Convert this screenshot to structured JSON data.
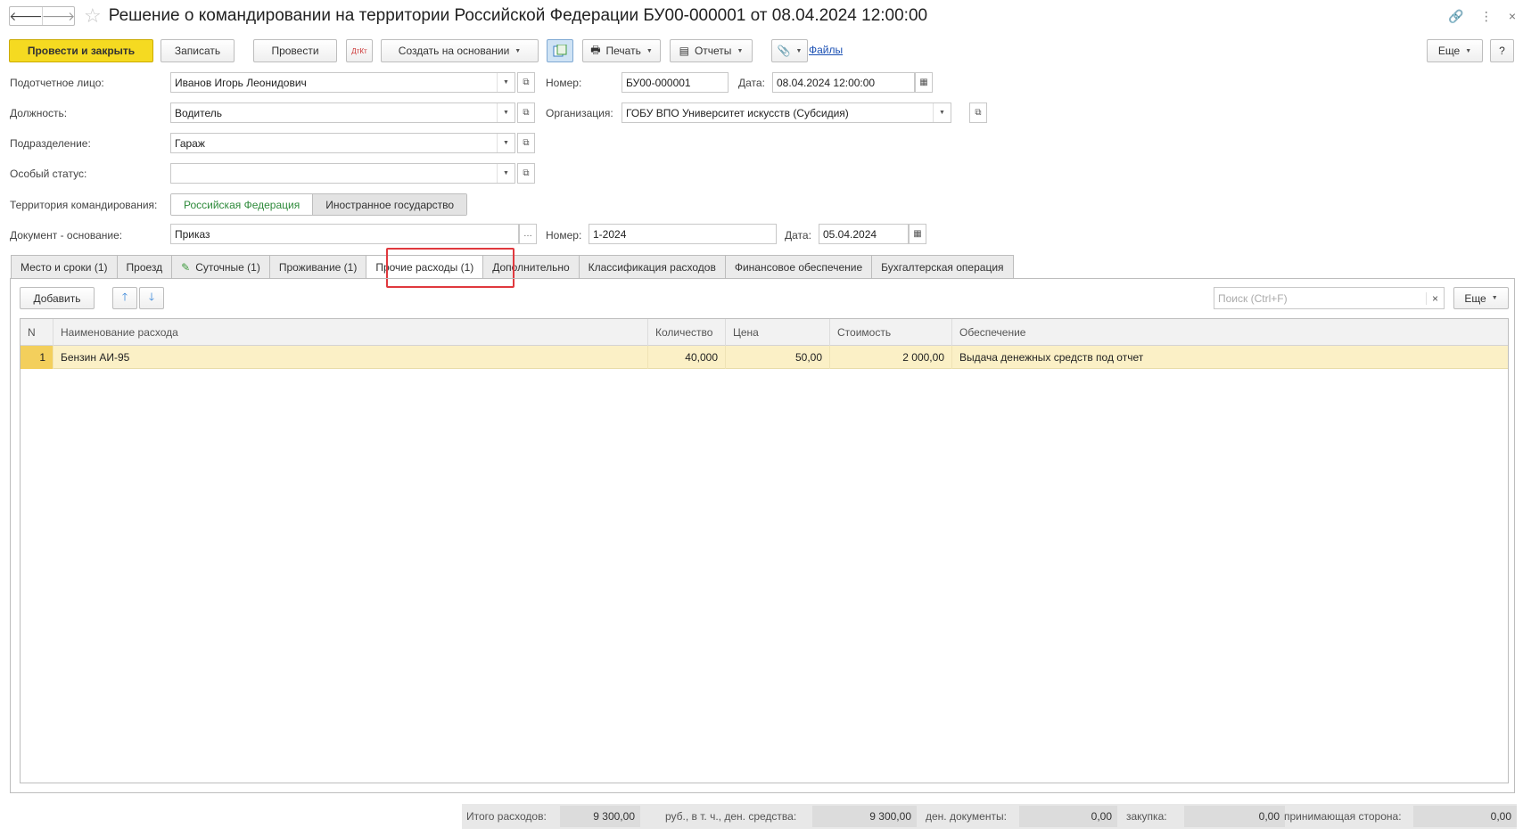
{
  "window": {
    "title": "Решение о командировании на территории Российской Федерации БУ00-000001 от 08.04.2024 12:00:00",
    "nav_back": "🡐",
    "nav_forward": "🡒",
    "star": "☆",
    "link_icon": "🔗",
    "more_icon": "⋮",
    "close_icon": "×"
  },
  "toolbar": {
    "post_and_close": "Провести и закрыть",
    "save": "Записать",
    "post": "Провести",
    "dt_kt": "ДтКт",
    "create_based_on": "Создать на основании",
    "print": "Печать",
    "reports": "Отчеты",
    "files": "Файлы",
    "more": "Еще",
    "help": "?"
  },
  "form": {
    "accountable_label": "Подотчетное лицо:",
    "accountable_value": "Иванов Игорь Леонидович",
    "position_label": "Должность:",
    "position_value": "Водитель",
    "department_label": "Подразделение:",
    "department_value": "Гараж",
    "special_status_label": "Особый статус:",
    "special_status_value": "",
    "territory_label": "Территория командирования:",
    "territory_options": [
      "Российская Федерация",
      "Иностранное государство"
    ],
    "territory_selected": "Российская Федерация",
    "basis_label": "Документ - основание:",
    "basis_value": "Приказ",
    "basis_number_label": "Номер:",
    "basis_number_value": "1-2024",
    "basis_date_label": "Дата:",
    "basis_date_value": "05.04.2024",
    "number_label": "Номер:",
    "number_value": "БУ00-000001",
    "date_label": "Дата:",
    "date_value": "08.04.2024 12:00:00",
    "org_label": "Организация:",
    "org_value": "ГОБУ ВПО Университет искусств (Субсидия)"
  },
  "tabs": [
    {
      "label": "Место и сроки (1)"
    },
    {
      "label": "Проезд"
    },
    {
      "label": "Суточные (1)"
    },
    {
      "label": "Проживание (1)"
    },
    {
      "label": "Прочие расходы (1)"
    },
    {
      "label": "Дополнительно"
    },
    {
      "label": "Классификация расходов"
    },
    {
      "label": "Финансовое обеспечение"
    },
    {
      "label": "Бухгалтерская операция"
    }
  ],
  "active_tab": "Прочие расходы (1)",
  "table_toolbar": {
    "add": "Добавить",
    "search_placeholder": "Поиск (Ctrl+F)",
    "more": "Еще"
  },
  "table": {
    "columns": [
      "N",
      "Наименование расхода",
      "Количество",
      "Цена",
      "Стоимость",
      "Обеспечение"
    ],
    "rows": [
      {
        "n": "1",
        "name": "Бензин АИ-95",
        "qty": "40,000",
        "price": "50,00",
        "cost": "2 000,00",
        "provision": "Выдача денежных средств под отчет"
      }
    ]
  },
  "footer": {
    "total_label": "Итого расходов:",
    "total_value": "9 300,00",
    "cash_label": "руб., в т. ч., ден. средства:",
    "cash_value": "9 300,00",
    "docs_label": "ден. документы:",
    "docs_value": "0,00",
    "purchase_label": "закупка:",
    "purchase_value": "0,00",
    "receiving_label": "принимающая сторона:",
    "receiving_value": "0,00"
  },
  "colors": {
    "primary_button": "#f5da21",
    "selected_row": "#fbf0c6",
    "highlight_border": "#e0393e",
    "active_segment": "#2d8a3a"
  }
}
